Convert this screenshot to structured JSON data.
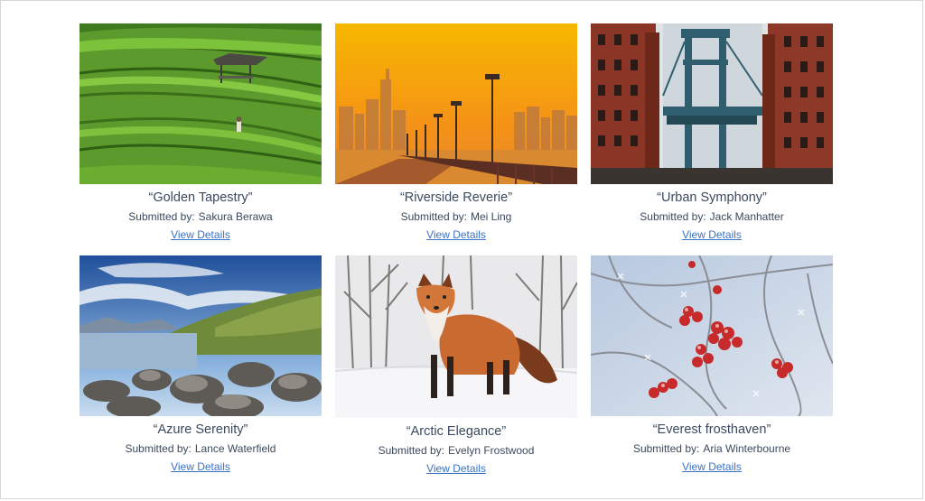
{
  "gallery": {
    "submitted_prefix": "Submitted by:",
    "link_label": "View Details",
    "link_color": "#3a73c4",
    "text_color": "#3b4a5e",
    "items": [
      {
        "title": "“Golden Tapestry”",
        "author": "Sakura Berawa",
        "image": "rice-terraces-photo"
      },
      {
        "title": "“Riverside Reverie”",
        "author": "Mei Ling",
        "image": "riverside-sunset-photo"
      },
      {
        "title": "“Urban Symphony”",
        "author": "Jack Manhatter",
        "image": "city-bridge-photo"
      },
      {
        "title": "“Azure Serenity”",
        "author": "Lance Waterfield",
        "image": "rocky-coast-photo"
      },
      {
        "title": "“Arctic Elegance”",
        "author": "Evelyn Frostwood",
        "image": "fox-in-snow-photo"
      },
      {
        "title": "“Everest frosthaven”",
        "author": "Aria Winterbourne",
        "image": "frosted-berries-photo"
      }
    ]
  }
}
